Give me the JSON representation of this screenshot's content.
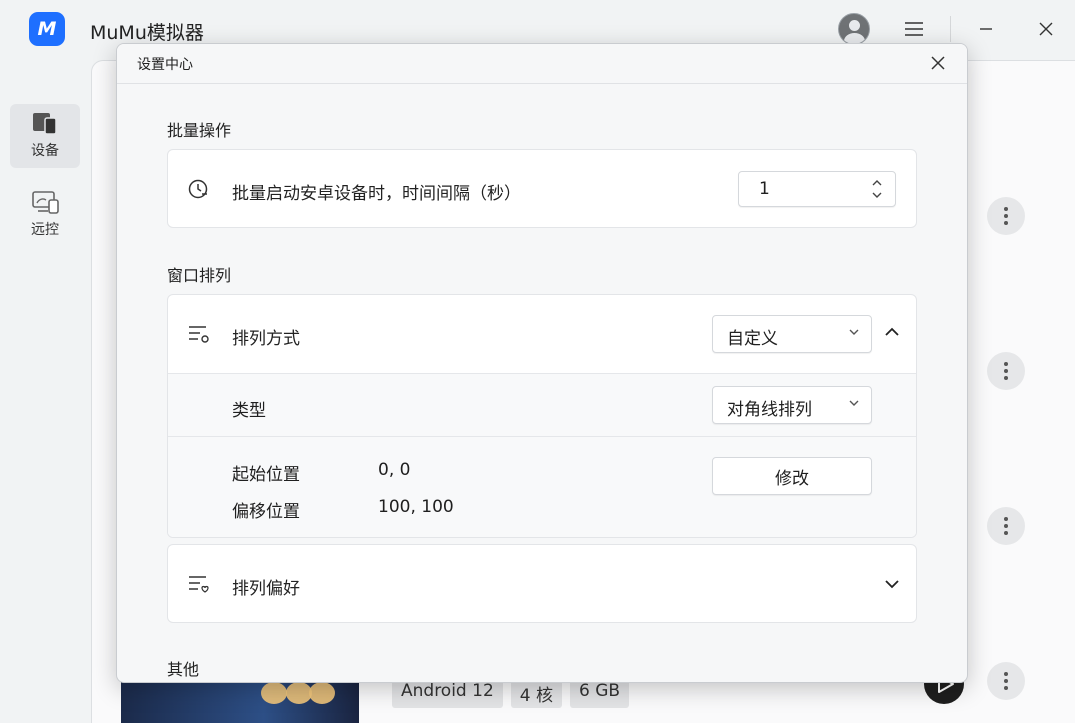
{
  "app": {
    "logo_text": "M",
    "title": "MuMu模拟器",
    "window_controls": {
      "menu": "menu-icon",
      "minimize": "minimize-icon",
      "close": "close-icon"
    }
  },
  "sidebar": {
    "items": [
      {
        "label": "设备",
        "icon": "device-icon",
        "active": true
      },
      {
        "label": "远控",
        "icon": "remote-control-icon",
        "active": false
      }
    ]
  },
  "background_device": {
    "chips": [
      "Android 12",
      "4 核",
      "6 GB"
    ]
  },
  "settings_dialog": {
    "title": "设置中心",
    "sections": {
      "batch": {
        "title": "批量操作",
        "interval_label": "批量启动安卓设备时，时间间隔（秒）",
        "interval_value": "1"
      },
      "window": {
        "title": "窗口排列",
        "arrange_mode_label": "排列方式",
        "arrange_mode_value": "自定义",
        "type_label": "类型",
        "type_value": "对角线排列",
        "start_pos_label": "起始位置",
        "start_pos_value": "0, 0",
        "offset_label": "偏移位置",
        "offset_value": "100, 100",
        "modify_button": "修改",
        "preference_label": "排列偏好"
      },
      "other": {
        "title": "其他"
      }
    }
  },
  "colors": {
    "accent": "#1e6fff",
    "dialog_bg": "#f6f7f8",
    "card_bg": "#ffffff"
  }
}
